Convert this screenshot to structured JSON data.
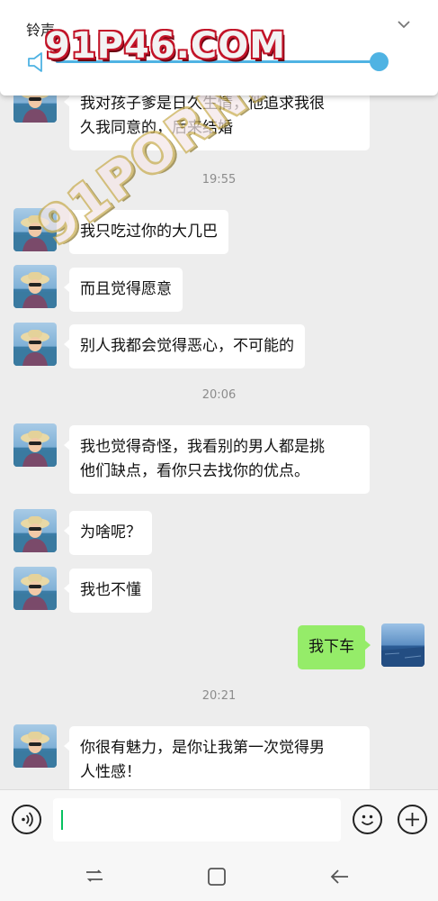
{
  "volume_popup": {
    "title": "铃声",
    "level": 0.97
  },
  "watermarks": {
    "top": "91P46.COM",
    "diagonal": "91PORN.COM"
  },
  "messages": [
    {
      "type": "in",
      "text_lines": [
        "我对孩子爹是日久生情，他追求我很",
        "久我同意的，后来结婚"
      ]
    },
    {
      "type": "time",
      "text": "19:55"
    },
    {
      "type": "in",
      "text_lines": [
        "我只吃过你的大几巴"
      ]
    },
    {
      "type": "in",
      "text_lines": [
        "而且觉得愿意"
      ]
    },
    {
      "type": "in",
      "text_lines": [
        "别人我都会觉得恶心，不可能的"
      ]
    },
    {
      "type": "time",
      "text": "20:06"
    },
    {
      "type": "in",
      "text_lines": [
        "我也觉得奇怪，我看别的男人都是挑",
        "他们缺点，看你只去找你的优点。"
      ]
    },
    {
      "type": "in",
      "text_lines": [
        "为啥呢？"
      ]
    },
    {
      "type": "in",
      "text_lines": [
        "我也不懂"
      ]
    },
    {
      "type": "out",
      "text_lines": [
        "我下车"
      ]
    },
    {
      "type": "time",
      "text": "20:21"
    },
    {
      "type": "in",
      "text_lines": [
        "你很有魅力，是你让我第一次觉得男",
        "人性感！"
      ]
    }
  ],
  "input_bar": {
    "voice_icon": "voice-icon",
    "emoji_icon": "emoji-icon",
    "plus_icon": "plus-icon",
    "text_value": ""
  },
  "nav_bar": {
    "icons": [
      "recents-icon",
      "home-icon",
      "back-icon"
    ]
  },
  "colors": {
    "chat_bg": "#ededed",
    "incoming_bubble": "#ffffff",
    "outgoing_bubble": "#95ec69",
    "accent_blue": "#4fb3e3",
    "caret_green": "#07c160",
    "watermark_red": "#c21428"
  }
}
